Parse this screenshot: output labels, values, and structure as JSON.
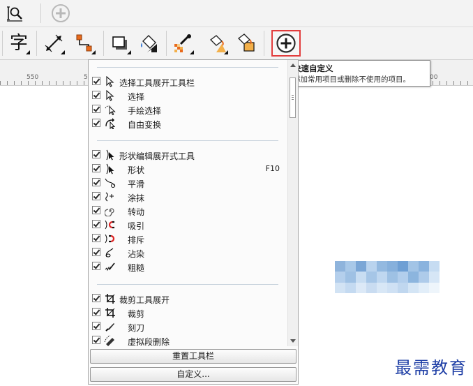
{
  "ruler": {
    "labels": [
      "550",
      "5",
      "00"
    ]
  },
  "tooltip": {
    "title": "快速自定义",
    "desc": "添加常用项目或删除不使用的项目。"
  },
  "toolbox_text_glyph": "字",
  "dropdown": {
    "groups": [
      {
        "label": "选择工具展开工具栏",
        "icon": "pointer-icon",
        "items": [
          {
            "label": "选择",
            "icon": "pointer-icon"
          },
          {
            "label": "手绘选择",
            "icon": "freehand-pick-icon"
          },
          {
            "label": "自由变换",
            "icon": "free-transform-icon"
          }
        ]
      },
      {
        "label": "形状编辑展开式工具",
        "icon": "shape-icon",
        "items": [
          {
            "label": "形状",
            "icon": "shape-icon",
            "shortcut": "F10"
          },
          {
            "label": "平滑",
            "icon": "smooth-icon"
          },
          {
            "label": "涂抹",
            "icon": "smear-icon"
          },
          {
            "label": "转动",
            "icon": "twirl-icon"
          },
          {
            "label": "吸引",
            "icon": "attract-icon"
          },
          {
            "label": "排斥",
            "icon": "repel-icon"
          },
          {
            "label": "沾染",
            "icon": "smudge-icon"
          },
          {
            "label": "粗糙",
            "icon": "roughen-icon"
          }
        ]
      },
      {
        "label": "裁剪工具展开",
        "icon": "crop-icon",
        "items": [
          {
            "label": "裁剪",
            "icon": "crop-icon"
          },
          {
            "label": "刻刀",
            "icon": "knife-icon"
          },
          {
            "label": "虚拟段删除",
            "icon": "virtual-segment-delete-icon"
          }
        ]
      }
    ],
    "reset_label": "重置工具栏",
    "customize_label": "自定义..."
  },
  "watermark": "最需教育",
  "colors": {
    "highlight_border": "#e23d3d",
    "watermark": "#1f3fa6",
    "toolbar_bg": "#f3f3f3"
  }
}
